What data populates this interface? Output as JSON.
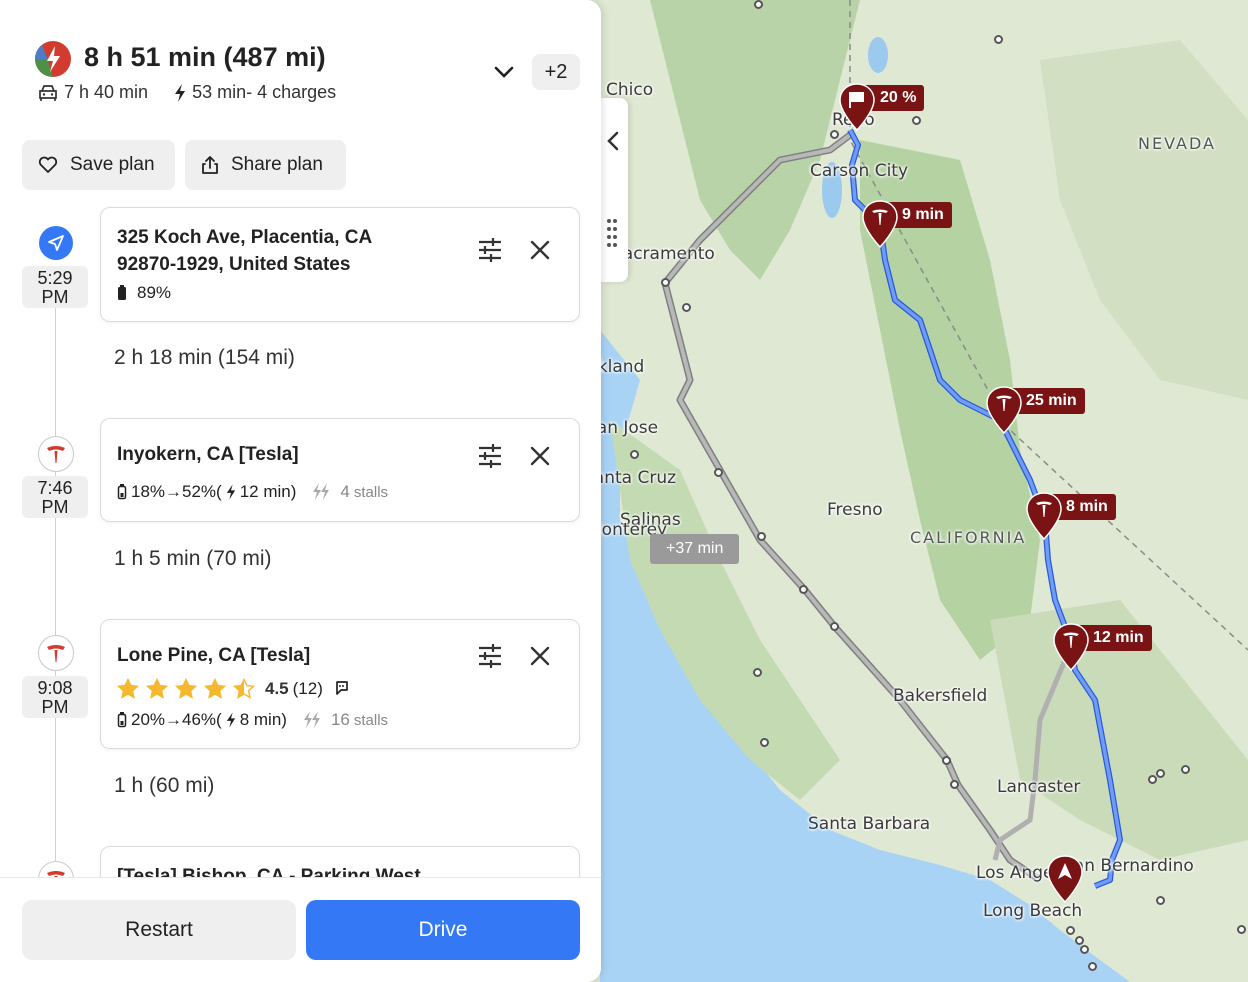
{
  "header": {
    "total": "8 h 51 min (487 mi)",
    "drive_time": "7 h 40 min",
    "charge_time": "53 min- 4 charges",
    "more_count": "+2"
  },
  "actions": {
    "save_label": "Save plan",
    "share_label": "Share plan"
  },
  "stops": [
    {
      "time_hm": "5:29",
      "time_ampm": "PM",
      "title_line1": "325 Koch Ave, Placentia, CA",
      "title_line2": "92870-1929, United States",
      "battery": "89%"
    },
    {
      "time_hm": "7:46",
      "time_ampm": "PM",
      "title_line1": "Inyokern, CA [Tesla]",
      "charge": "18%→52%(",
      "charge_min": "12 min)",
      "stalls": "4",
      "stalls_label": "stalls"
    },
    {
      "time_hm": "9:08",
      "time_ampm": "PM",
      "title_line1": "Lone Pine, CA [Tesla]",
      "rating": "4.5",
      "rating_count": "(12)",
      "rating_value": 4.5,
      "charge": "20%→46%(",
      "charge_min": "8 min)",
      "stalls": "16",
      "stalls_label": "stalls"
    },
    {
      "title_line1": "[Tesla] Bishop, CA - Parking West"
    }
  ],
  "legs": [
    "2 h 18 min (154 mi)",
    "1 h 5 min (70 mi)",
    "1 h (60 mi)"
  ],
  "footer": {
    "restart_label": "Restart",
    "drive_label": "Drive"
  },
  "map": {
    "cities": [
      "Chico",
      "Reno",
      "Carson City",
      "Sacramento",
      "San Jose",
      "Santa Cruz",
      "Salinas",
      "Monterey",
      "Fresno",
      "Bakersfield",
      "Lancaster",
      "Santa Barbara",
      "Los Angeles",
      "San Bernardino",
      "Long Beach",
      "Oakland"
    ],
    "regions": [
      "NEVADA",
      "CALIFORNIA"
    ],
    "markers": [
      "20 %",
      "9 min",
      "25 min",
      "8 min",
      "12 min"
    ],
    "alt_route": "+37 min"
  },
  "colors": {
    "accent": "#3478f6",
    "tesla_red": "#7a1414",
    "route_blue": "#4f7ff0",
    "alt_route_gray": "#9a9a9a"
  }
}
